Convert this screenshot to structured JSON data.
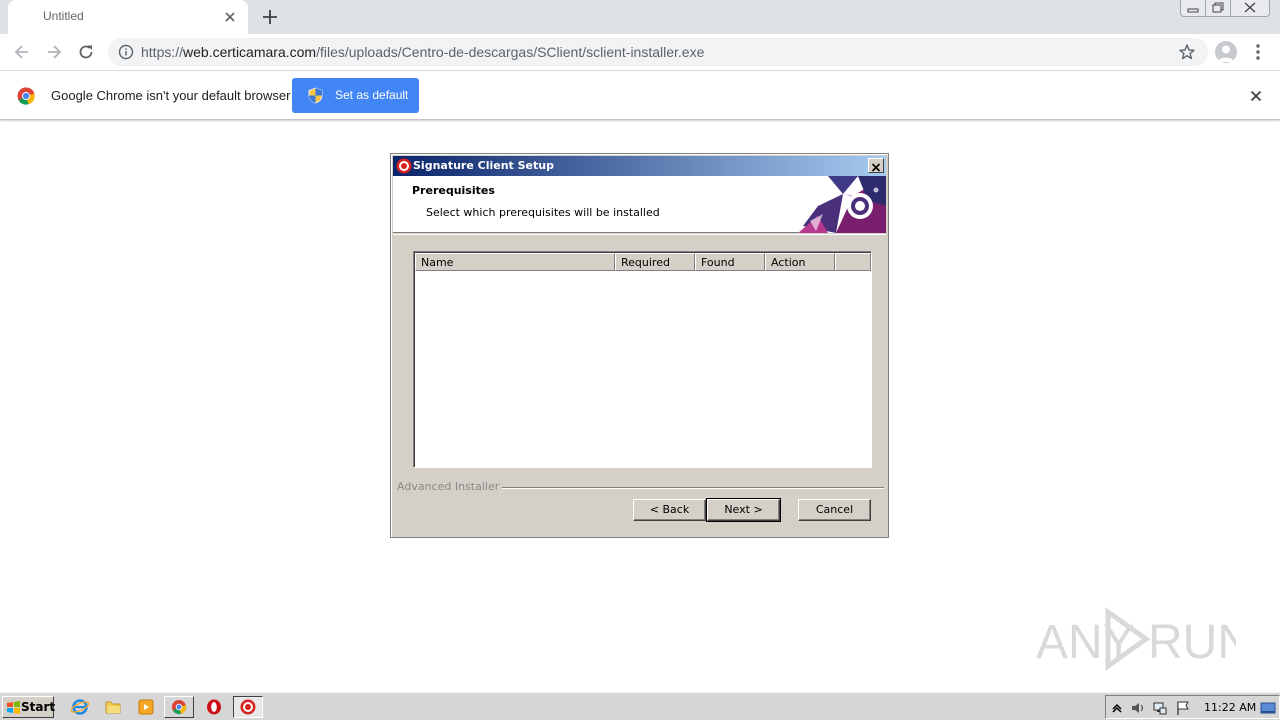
{
  "browser": {
    "tab_title": "Untitled",
    "url_scheme": "https://",
    "url_host": "web.certicamara.com",
    "url_path": "/files/uploads/Centro-de-descargas/SClient/sclient-installer.exe",
    "accent": "#4285f4"
  },
  "infobar": {
    "message": "Google Chrome isn't your default browser",
    "button_label": "Set as default"
  },
  "dialog": {
    "title": "Signature Client Setup",
    "header_title": "Prerequisites",
    "header_subtitle": "Select which prerequisites will be installed",
    "columns": [
      "Name",
      "Required",
      "Found",
      "Action",
      ""
    ],
    "rows": [],
    "branding": "Advanced Installer",
    "buttons": {
      "back": "< Back",
      "next": "Next >",
      "cancel": "Cancel"
    }
  },
  "taskbar": {
    "start_label": "Start",
    "clock": "11:22 AM"
  },
  "watermark": {
    "text_left": "ANY",
    "text_right": "RUN"
  }
}
